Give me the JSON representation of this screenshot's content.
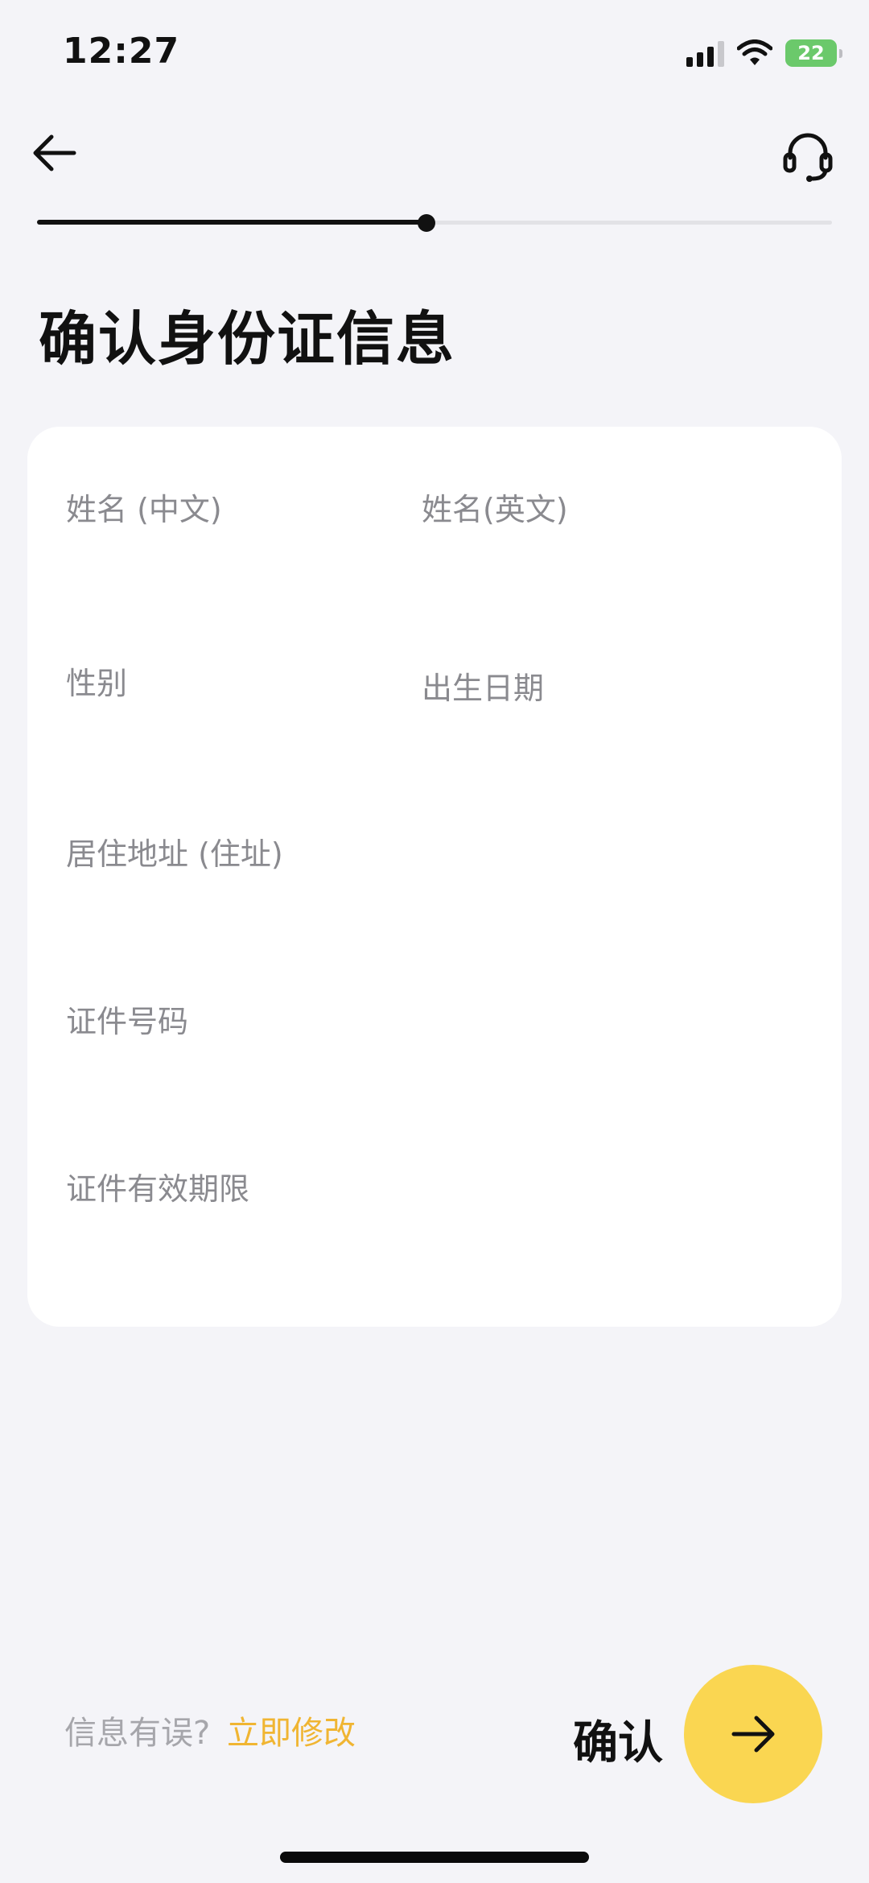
{
  "status_bar": {
    "time": "12:27",
    "battery": "22"
  },
  "nav": {
    "back_icon": "arrow-left-icon",
    "support_icon": "headset-icon"
  },
  "progress": {
    "fraction": 0.49
  },
  "page_title": "确认身份证信息",
  "form": {
    "name_cn_label": "姓名 (中文)",
    "name_en_label": "姓名(英文)",
    "gender_label": "性别",
    "birthdate_label": "出生日期",
    "address_label": "居住地址 (住址)",
    "id_number_label": "证件号码",
    "expiry_label": "证件有效期限"
  },
  "footer": {
    "hint": "信息有误?",
    "edit_link": "立即修改",
    "confirm_label": "确认",
    "confirm_icon": "arrow-right-icon"
  },
  "colors": {
    "background": "#f4f4f8",
    "accent": "#fad651",
    "link": "#f0b532"
  }
}
